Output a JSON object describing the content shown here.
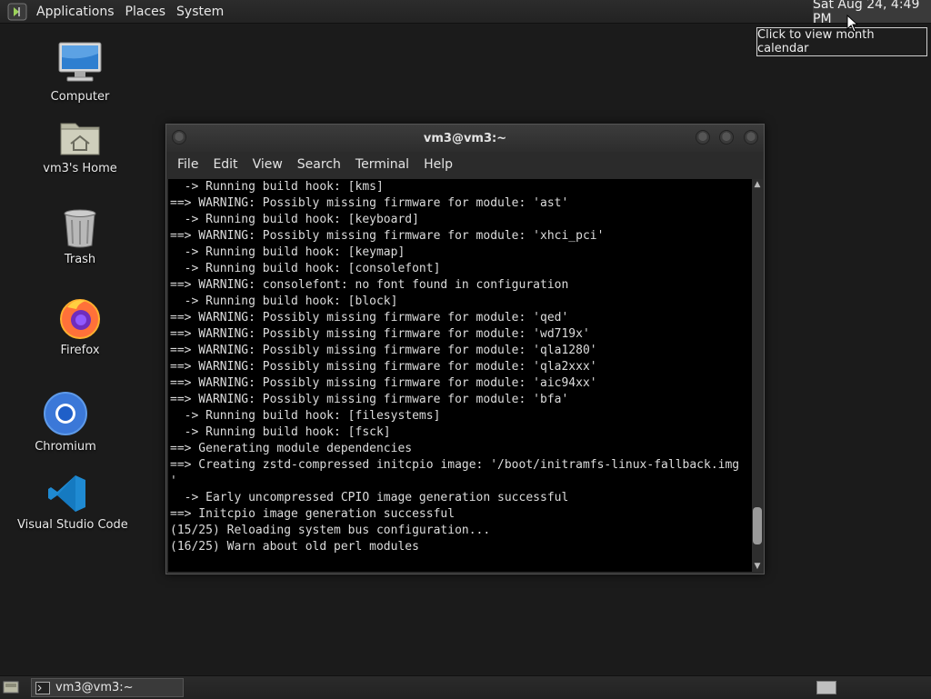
{
  "top_panel": {
    "menus": [
      "Applications",
      "Places",
      "System"
    ],
    "clock": "Sat Aug 24,  4:49 PM",
    "tooltip": "Click to view month calendar"
  },
  "desktop": {
    "icons": [
      "Computer",
      "vm3's Home",
      "Trash",
      "Firefox",
      "Chromium",
      "Visual Studio Code"
    ]
  },
  "terminal": {
    "title": "vm3@vm3:~",
    "menus": [
      "File",
      "Edit",
      "View",
      "Search",
      "Terminal",
      "Help"
    ],
    "lines": [
      "  -> Running build hook: [kms]",
      "==> WARNING: Possibly missing firmware for module: 'ast'",
      "  -> Running build hook: [keyboard]",
      "==> WARNING: Possibly missing firmware for module: 'xhci_pci'",
      "  -> Running build hook: [keymap]",
      "  -> Running build hook: [consolefont]",
      "==> WARNING: consolefont: no font found in configuration",
      "  -> Running build hook: [block]",
      "==> WARNING: Possibly missing firmware for module: 'qed'",
      "==> WARNING: Possibly missing firmware for module: 'wd719x'",
      "==> WARNING: Possibly missing firmware for module: 'qla1280'",
      "==> WARNING: Possibly missing firmware for module: 'qla2xxx'",
      "==> WARNING: Possibly missing firmware for module: 'aic94xx'",
      "==> WARNING: Possibly missing firmware for module: 'bfa'",
      "  -> Running build hook: [filesystems]",
      "  -> Running build hook: [fsck]",
      "==> Generating module dependencies",
      "==> Creating zstd-compressed initcpio image: '/boot/initramfs-linux-fallback.img",
      "'",
      "  -> Early uncompressed CPIO image generation successful",
      "==> Initcpio image generation successful",
      "(15/25) Reloading system bus configuration...",
      "(16/25) Warn about old perl modules"
    ],
    "scroll_position_fraction": 0.95,
    "scroll_visible_fraction": 0.1
  },
  "taskbar": {
    "window_button": "vm3@vm3:~"
  },
  "colors": {
    "desktop_bg": "#1b1b1b",
    "terminal_bg": "#000000",
    "terminal_fg": "#dcdcdc",
    "chromium_blue": "#3b78d8",
    "vscode_blue": "#1f8ad2"
  }
}
